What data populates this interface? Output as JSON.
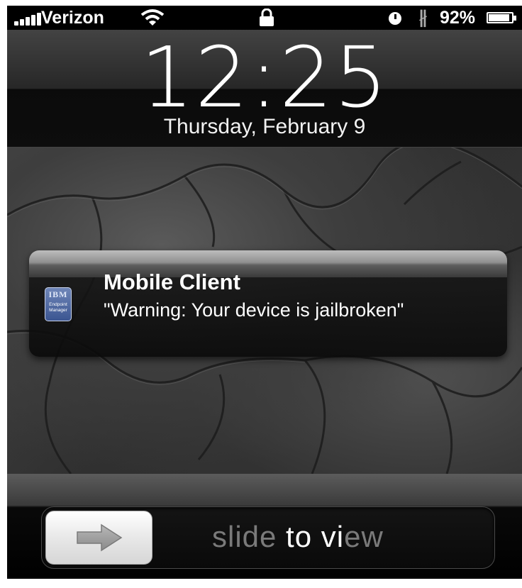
{
  "status_bar": {
    "carrier": "Verizon",
    "battery_percent": "92%",
    "battery_level": 0.92,
    "bluetooth_symbol": "∦",
    "icons": [
      "signal-icon",
      "wifi-icon",
      "lock-icon",
      "alarm-clock-icon",
      "bluetooth-icon",
      "battery-icon"
    ]
  },
  "lock_screen": {
    "time": "12:25",
    "date": "Thursday, February 9"
  },
  "notification": {
    "app_icon": {
      "name": "ibm-endpoint-manager-icon",
      "brand": "IBM",
      "caption": "Endpoint Manager"
    },
    "title": "Mobile Client",
    "message": "\"Warning: Your device is jailbroken\""
  },
  "slider": {
    "label_part1": "slide",
    "label_part2": " to vi",
    "label_part3": "ew",
    "icon": "arrow-right-icon"
  },
  "colors": {
    "status_bar_bg": "#000000",
    "text_primary": "#ffffff",
    "slider_dim_text": "#7a7a7a",
    "app_icon_blue": "#3b5591"
  }
}
